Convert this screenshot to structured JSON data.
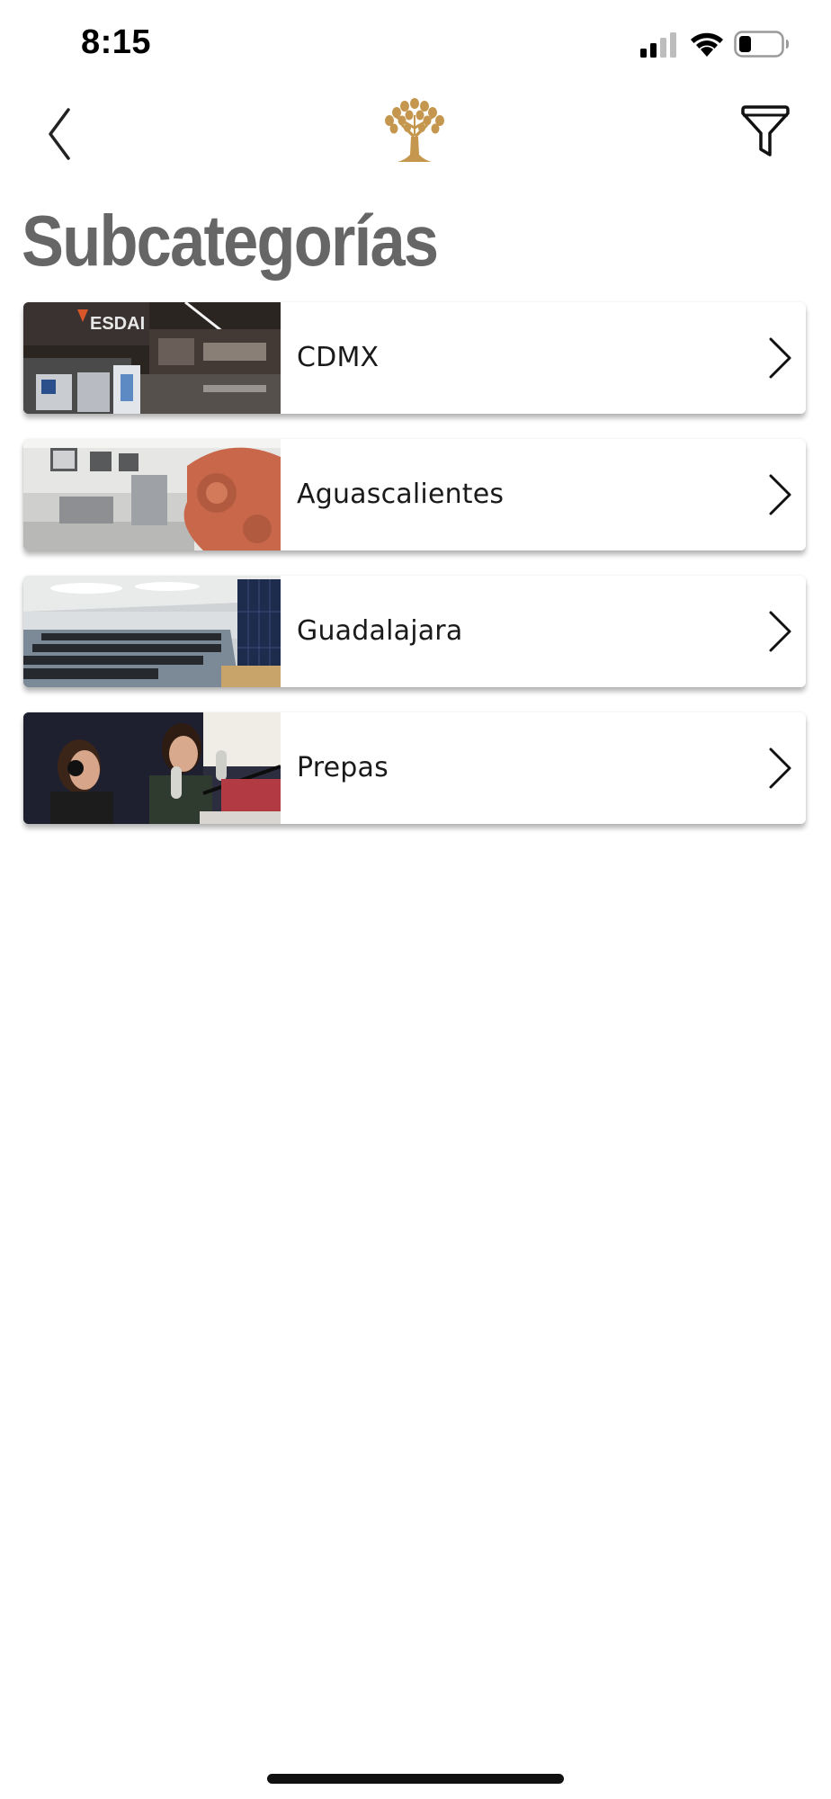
{
  "status_bar": {
    "time": "8:15"
  },
  "nav": {
    "back_icon": "chevron-left-icon",
    "logo_icon": "tree-logo-icon",
    "filter_icon": "funnel-filter-icon"
  },
  "page": {
    "title": "Subcategorías"
  },
  "subcategories": [
    {
      "label": "CDMX",
      "image": "kitchen-lab-photo"
    },
    {
      "label": "Aguascalientes",
      "image": "robotics-lab-photo"
    },
    {
      "label": "Guadalajara",
      "image": "auditorium-photo"
    },
    {
      "label": "Prepas",
      "image": "radio-studio-photo"
    }
  ],
  "colors": {
    "title": "#666666",
    "logo_gold": "#C4964E",
    "chevron": "#111111"
  }
}
